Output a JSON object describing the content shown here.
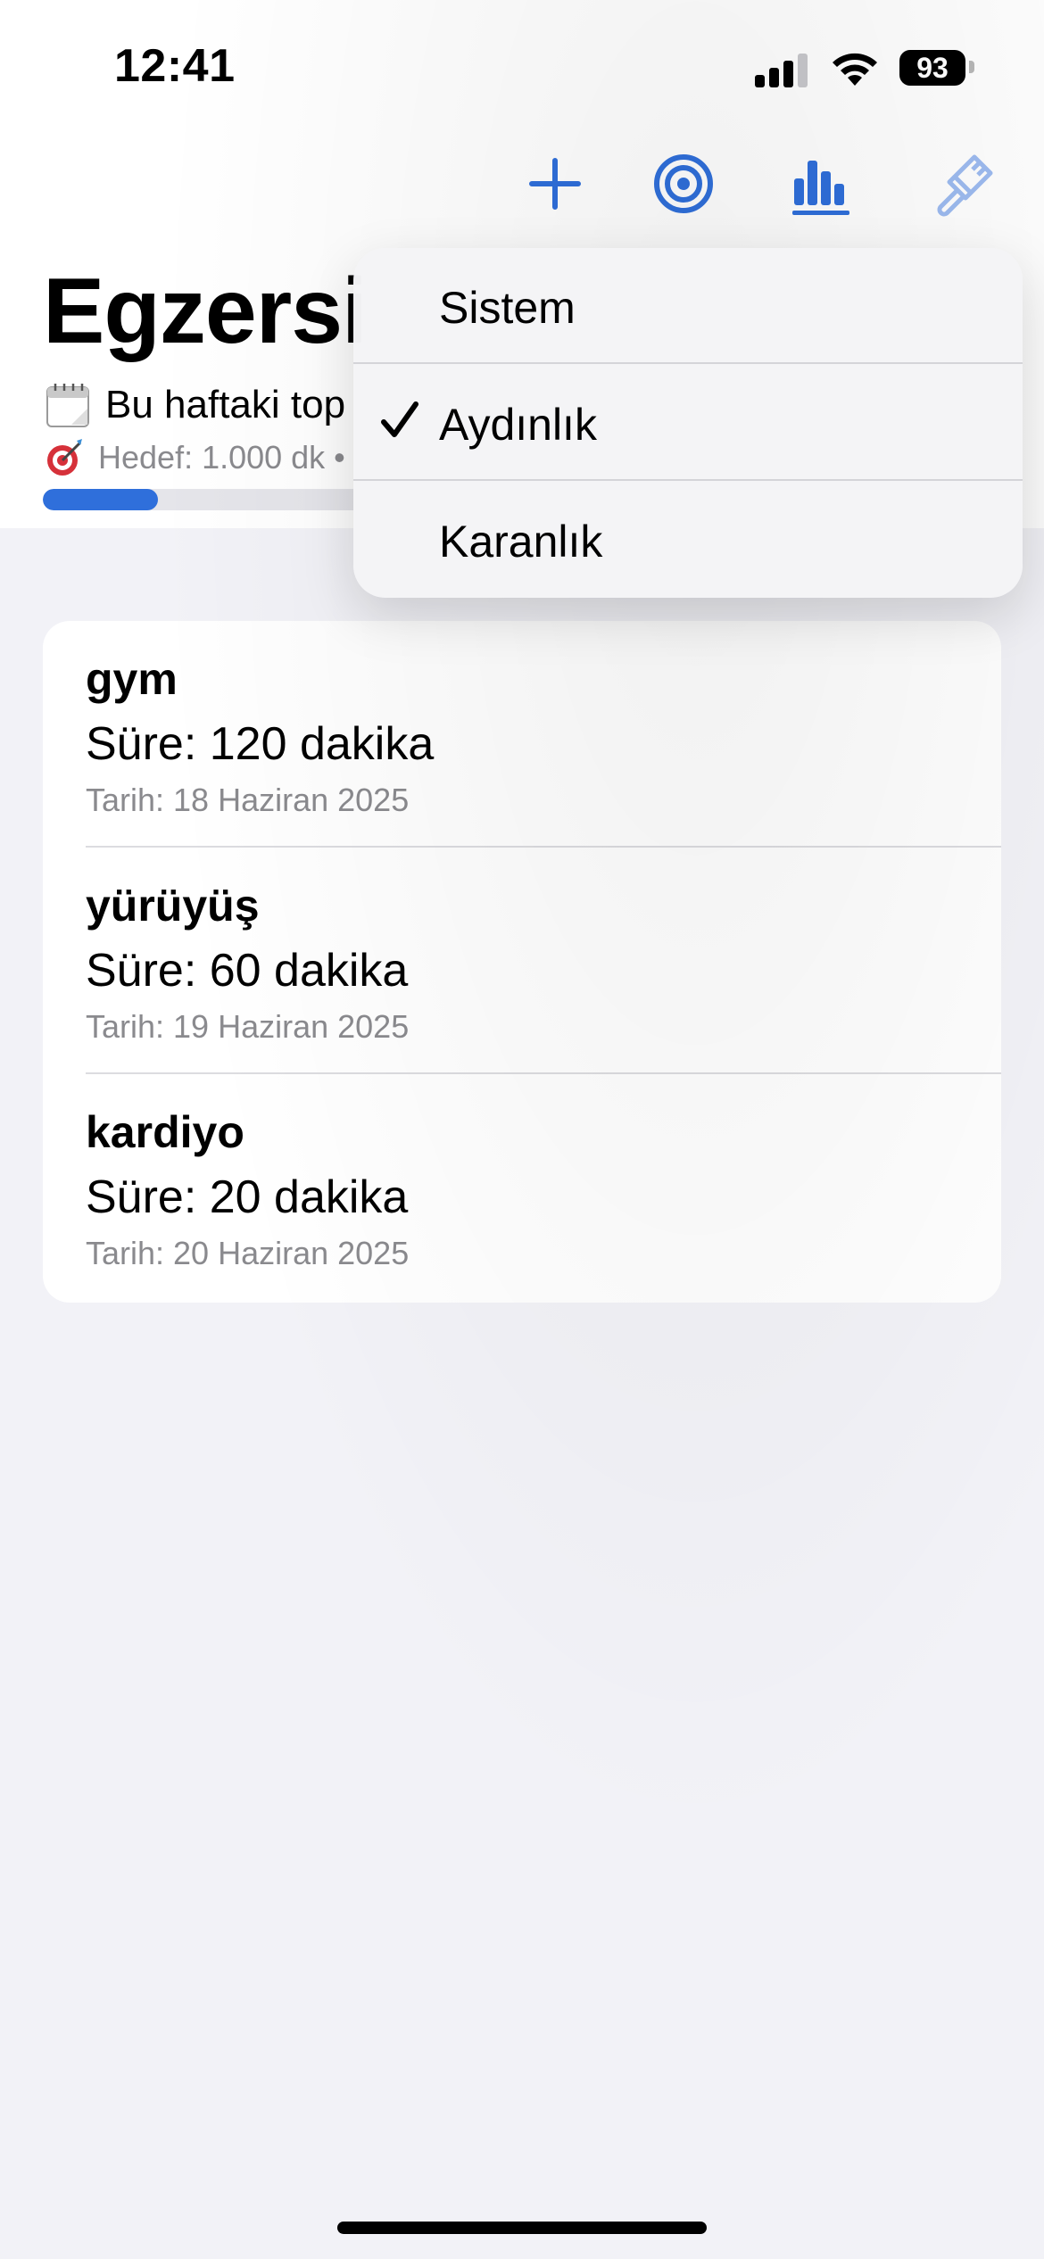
{
  "status_bar": {
    "time": "12:41",
    "battery": "93"
  },
  "toolbar": {
    "add_icon": "plus-icon",
    "goal_icon": "target-icon",
    "stats_icon": "bar-chart-icon",
    "theme_icon": "paintbrush-icon"
  },
  "header": {
    "title": "Egzersi",
    "weekly_text": "Bu haftaki top",
    "goal_text": "Hedef: 1.000 dk •",
    "progress_fraction": 0.12
  },
  "theme_menu": {
    "items": [
      {
        "label": "Sistem",
        "selected": false
      },
      {
        "label": "Aydınlık",
        "selected": true
      },
      {
        "label": "Karanlık",
        "selected": false
      }
    ]
  },
  "workouts": [
    {
      "name": "gym",
      "duration": "Süre: 120 dakika",
      "date": "Tarih: 18 Haziran 2025"
    },
    {
      "name": "yürüyüş",
      "duration": "Süre: 60 dakika",
      "date": "Tarih: 19 Haziran 2025"
    },
    {
      "name": "kardiyo",
      "duration": "Süre: 20 dakika",
      "date": "Tarih: 20 Haziran 2025"
    }
  ],
  "colors": {
    "accent": "#2f6fdb",
    "background": "#f2f2f7",
    "secondary_text": "#8a8a8e"
  }
}
